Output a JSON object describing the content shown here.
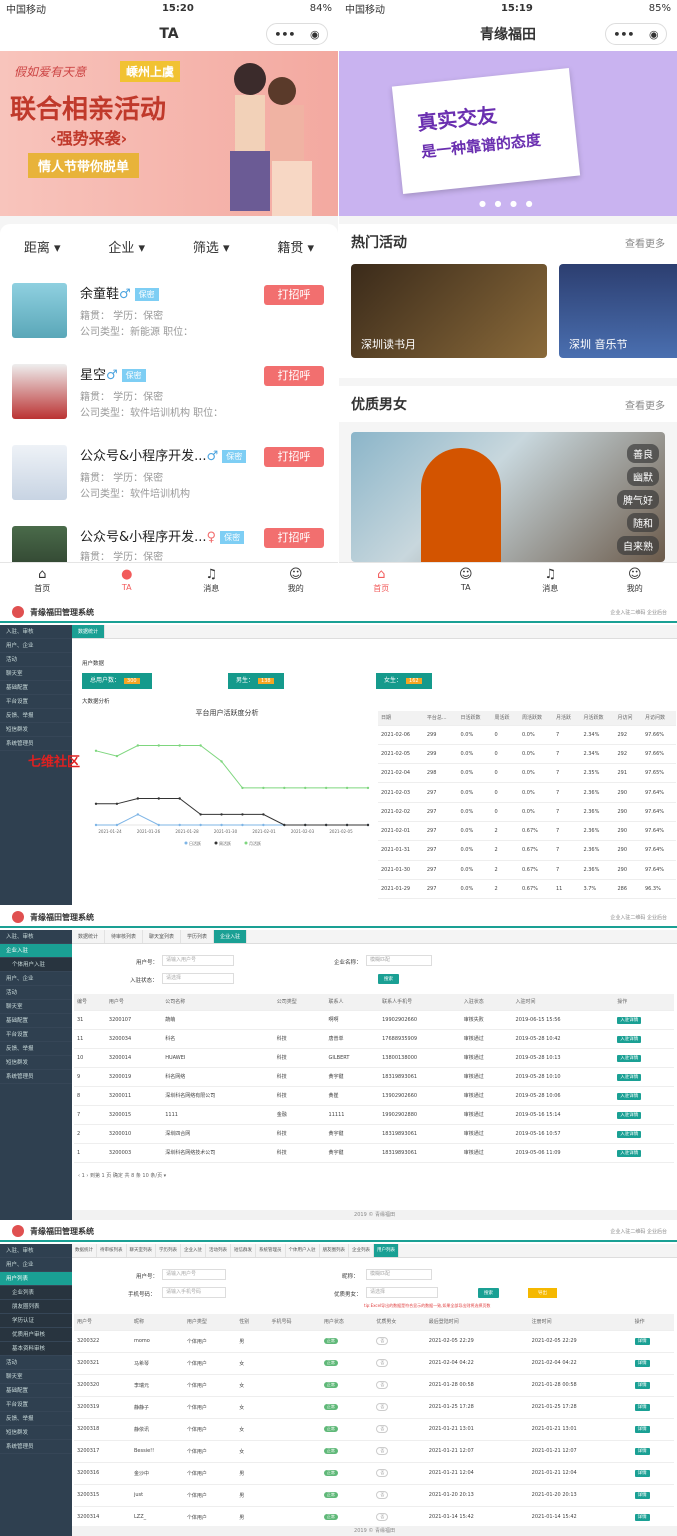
{
  "phone1": {
    "carrier": "中国移动",
    "time": "15:20",
    "battery": "84%",
    "title": "TA",
    "banner": {
      "line1": "假如爱有天意",
      "badge": "嵊州上虞",
      "line2": "联合相亲活动",
      "line3": "‹强势来袭›",
      "line4": "情人节带你脱单",
      "color": "#f7b7b0"
    },
    "filters": [
      "距离 ▾",
      "企业 ▾",
      "筛选 ▾",
      "籍贯 ▾"
    ],
    "people": [
      {
        "name": "余童鞋",
        "gender": "♂",
        "tag": "保密",
        "l1": "籍贯：   学历：保密",
        "l2": "公司类型：新能源    职位：",
        "btn": "打招呼"
      },
      {
        "name": "星空",
        "gender": "♂",
        "tag": "保密",
        "l1": "籍贯：   学历：保密",
        "l2": "公司类型：软件培训机构    职位：",
        "btn": "打招呼"
      },
      {
        "name": "公众号&小程序开发...",
        "gender": "♂",
        "tag": "保密",
        "l1": "籍贯：   学历：保密",
        "l2": "公司类型：软件培训机构",
        "btn": "打招呼"
      },
      {
        "name": "公众号&小程序开发...",
        "gender": "♀",
        "tag": "保密",
        "l1": "籍贯：   学历：保密",
        "l2": "",
        "btn": "打招呼"
      }
    ],
    "tabs": [
      {
        "icon": "⌂",
        "label": "首页"
      },
      {
        "icon": "●",
        "label": "TA"
      },
      {
        "icon": "♫",
        "label": "消息"
      },
      {
        "icon": "☺",
        "label": "我的"
      }
    ]
  },
  "phone2": {
    "carrier": "中国移动",
    "time": "15:19",
    "battery": "85%",
    "title": "青缘福田",
    "banner": {
      "line1": "真实交友",
      "line2": "是一种靠谱的态度"
    },
    "hot": {
      "title": "热门活动",
      "more": "查看更多",
      "cards": [
        "深圳读书月",
        "深圳 音乐节"
      ]
    },
    "quality": {
      "title": "优质男女",
      "more": "查看更多",
      "tags": [
        "善良",
        "幽默",
        "脾气好",
        "随和",
        "自来熟"
      ]
    },
    "tabs": [
      {
        "icon": "⌂",
        "label": "首页"
      },
      {
        "icon": "☺",
        "label": "TA"
      },
      {
        "icon": "♫",
        "label": "消息"
      },
      {
        "icon": "☺",
        "label": "我的"
      }
    ]
  },
  "admin1": {
    "brand": "青缘福田管理系统",
    "header_right": "企业入驻二维码    企业后台",
    "sidebar": [
      "入驻、审核",
      "用户、企业",
      "活动",
      "聊天室",
      "基础配置",
      "平台设置",
      "反馈、举报",
      "短信群发",
      "系统管理员"
    ],
    "tabs": [
      "数据统计"
    ],
    "user_data_label": "用户数据",
    "cards": [
      {
        "label": "总用户数：",
        "val": "300"
      },
      {
        "label": "男生：",
        "val": "138"
      },
      {
        "label": "女生：",
        "val": "162"
      }
    ],
    "big_label": "大数据分析",
    "watermark": "七维社区",
    "chart_data": {
      "type": "line",
      "title": "平台用户活跃度分析",
      "categories": [
        "2021-01-24",
        "2021-01-26",
        "2021-01-28",
        "2021-01-30",
        "2021-02-01",
        "2021-02-03",
        "2021-02-05"
      ],
      "ylim": [
        0,
        20
      ],
      "legend": "bottom",
      "series": [
        {
          "name": "日活跃",
          "color": "#7eb5e6",
          "values": [
            0,
            0,
            2,
            0,
            0,
            0,
            0,
            0,
            0,
            0,
            0,
            0,
            0,
            0
          ]
        },
        {
          "name": "周活跃",
          "color": "#333333",
          "values": [
            4,
            4,
            5,
            5,
            5,
            2,
            2,
            2,
            2,
            0,
            0,
            0,
            0,
            0
          ]
        },
        {
          "name": "月活跃",
          "color": "#7ed67e",
          "values": [
            14,
            13,
            15,
            15,
            15,
            15,
            12,
            7,
            7,
            7,
            7,
            7,
            7,
            7
          ]
        }
      ]
    },
    "table": {
      "headers": [
        "日期",
        "平台总...",
        "日活跃数",
        "周活跃",
        "周活跃数",
        "月活跃",
        "月活跃数",
        "月访问",
        "月访问数"
      ],
      "rows": [
        [
          "2021-02-06",
          "299",
          "0.0%",
          "0",
          "0.0%",
          "7",
          "2.34%",
          "292",
          "97.66%"
        ],
        [
          "2021-02-05",
          "299",
          "0.0%",
          "0",
          "0.0%",
          "7",
          "2.34%",
          "292",
          "97.66%"
        ],
        [
          "2021-02-04",
          "298",
          "0.0%",
          "0",
          "0.0%",
          "7",
          "2.35%",
          "291",
          "97.65%"
        ],
        [
          "2021-02-03",
          "297",
          "0.0%",
          "0",
          "0.0%",
          "7",
          "2.36%",
          "290",
          "97.64%"
        ],
        [
          "2021-02-02",
          "297",
          "0.0%",
          "0",
          "0.0%",
          "7",
          "2.36%",
          "290",
          "97.64%"
        ],
        [
          "2021-02-01",
          "297",
          "0.0%",
          "2",
          "0.67%",
          "7",
          "2.36%",
          "290",
          "97.64%"
        ],
        [
          "2021-01-31",
          "297",
          "0.0%",
          "2",
          "0.67%",
          "7",
          "2.36%",
          "290",
          "97.64%"
        ],
        [
          "2021-01-30",
          "297",
          "0.0%",
          "2",
          "0.67%",
          "7",
          "2.36%",
          "290",
          "97.64%"
        ],
        [
          "2021-01-29",
          "297",
          "0.0%",
          "2",
          "0.67%",
          "11",
          "3.7%",
          "286",
          "96.3%"
        ]
      ]
    }
  },
  "admin2": {
    "brand": "青缘福田管理系统",
    "header_right": "企业入驻二维码    企业后台",
    "sidebar": [
      "入驻、审核",
      "企业入驻",
      "个体用户入驻",
      "用户、企业",
      "活动",
      "聊天室",
      "基础配置",
      "平台设置",
      "反馈、举报",
      "短信群发",
      "系统管理员"
    ],
    "tabs": [
      "数据统计",
      "待审核列表",
      "聊天室列表",
      "学历列表",
      "企业入驻"
    ],
    "form": {
      "user_label": "用户号：",
      "user_ph": "请输入用户号",
      "company_label": "企业名称：",
      "company_ph": "模糊匹配",
      "status_label": "入驻状态：",
      "status_ph": "请选择",
      "search": "搜索"
    },
    "headers": [
      "编号",
      "用户号",
      "公司名称",
      "公司类型",
      "联系人",
      "联系人手机号",
      "入驻状态",
      "入驻时间",
      "操作"
    ],
    "rows": [
      [
        "31",
        "3200107",
        "蔬萌",
        "",
        "啊啊",
        "19902902660",
        "审核失败",
        "2019-06-15 15:56",
        "入驻详情"
      ],
      [
        "11",
        "3200034",
        "科名",
        "科技",
        "唐普单",
        "17688935909",
        "审核通过",
        "2019-05-28 10:42",
        "入驻详情"
      ],
      [
        "10",
        "3200014",
        "HUAWEI",
        "科技",
        "GILBERT",
        "13800138000",
        "审核通过",
        "2019-05-28 10:13",
        "入驻详情"
      ],
      [
        "9",
        "3200019",
        "科名网络",
        "科技",
        "黄宇键",
        "18319893061",
        "审核通过",
        "2019-05-28 10:10",
        "入驻详情"
      ],
      [
        "8",
        "3200011",
        "深圳科名网络有限公司",
        "科技",
        "黄崔",
        "13902902660",
        "审核通过",
        "2019-05-28 10:06",
        "入驻详情"
      ],
      [
        "7",
        "3200015",
        "1111",
        "金融",
        "11111",
        "19902902880",
        "审核通过",
        "2019-05-16 15:14",
        "入驻详情"
      ],
      [
        "2",
        "3200010",
        "深圳四合网",
        "科技",
        "黄宇键",
        "18319893061",
        "审核通过",
        "2019-05-16 10:57",
        "入驻详情"
      ],
      [
        "1",
        "3200003",
        "深圳科名网络技术公司",
        "科技",
        "黄宇键",
        "18319893061",
        "审核通过",
        "2019-05-06 11:09",
        "入驻详情"
      ]
    ],
    "pager": "‹  1  ›   到第  1  页   确定   共 8 条   10 条/页 ▾",
    "footer": "2019 © 青缘福田"
  },
  "admin3": {
    "brand": "青缘福田管理系统",
    "header_right": "企业入驻二维码    企业后台",
    "sidebar": [
      "入驻、审核",
      "用户、企业",
      "用户列表",
      "企业列表",
      "朋友圈列表",
      "学历认证",
      "优质用户审核",
      "基本资料审核",
      "活动",
      "聊天室",
      "基础配置",
      "平台设置",
      "反馈、举报",
      "短信群发",
      "系统管理员"
    ],
    "tabs": [
      "数据统计",
      "待审核列表",
      "聊天室列表",
      "学历列表",
      "企业入驻",
      "活动列表",
      "短信群发",
      "系统管理员",
      "个体用户入驻",
      "朋友圈列表",
      "企业列表",
      "用户列表"
    ],
    "form": {
      "user_label": "用户号：",
      "user_ph": "请输入用户号",
      "nick_label": "昵称：",
      "nick_ph": "模糊匹配",
      "phone_label": "手机号码：",
      "phone_ph": "请输入手机号码",
      "quality_label": "优质男女：",
      "quality_ph": "请选择",
      "search": "搜索",
      "export": "导出",
      "tip": "tip:Excel导出的数据是符合显示的数据一致,如果全部导出则将选择页数"
    },
    "headers": [
      "用户号",
      "昵称",
      "用户类型",
      "性别",
      "手机号码",
      "用户状态",
      "优质男女",
      "最后登陆时间",
      "注册时间",
      "操作"
    ],
    "rows": [
      [
        "3200322",
        "momo",
        "个体用户",
        "男",
        "",
        "正常",
        "否",
        "2021-02-05 22:29",
        "2021-02-05 22:29",
        "详情"
      ],
      [
        "3200321",
        "马希琴",
        "个体用户",
        "女",
        "",
        "正常",
        "否",
        "2021-02-04 04:22",
        "2021-02-04 04:22",
        "详情"
      ],
      [
        "3200320",
        "李瑞元",
        "个体用户",
        "女",
        "",
        "正常",
        "否",
        "2021-01-28 00:58",
        "2021-01-28 00:58",
        "详情"
      ],
      [
        "3200319",
        "静静子",
        "个体用户",
        "女",
        "",
        "正常",
        "否",
        "2021-01-25 17:28",
        "2021-01-25 17:28",
        "详情"
      ],
      [
        "3200318",
        "静依讯",
        "个体用户",
        "女",
        "",
        "正常",
        "否",
        "2021-01-21 13:01",
        "2021-01-21 13:01",
        "详情"
      ],
      [
        "3200317",
        "Bessie!!",
        "个体用户",
        "女",
        "",
        "正常",
        "否",
        "2021-01-21 12:07",
        "2021-01-21 12:07",
        "详情"
      ],
      [
        "3200316",
        "金沙中",
        "个体用户",
        "男",
        "",
        "正常",
        "否",
        "2021-01-21 12:04",
        "2021-01-21 12:04",
        "详情"
      ],
      [
        "3200315",
        "just",
        "个体用户",
        "男",
        "",
        "正常",
        "否",
        "2021-01-20 20:13",
        "2021-01-20 20:13",
        "详情"
      ],
      [
        "3200314",
        "LZZ_",
        "个体用户",
        "男",
        "",
        "正常",
        "否",
        "2021-01-14 15:42",
        "2021-01-14 15:42",
        "详情"
      ]
    ],
    "footer": "2019 © 青缘福田"
  }
}
